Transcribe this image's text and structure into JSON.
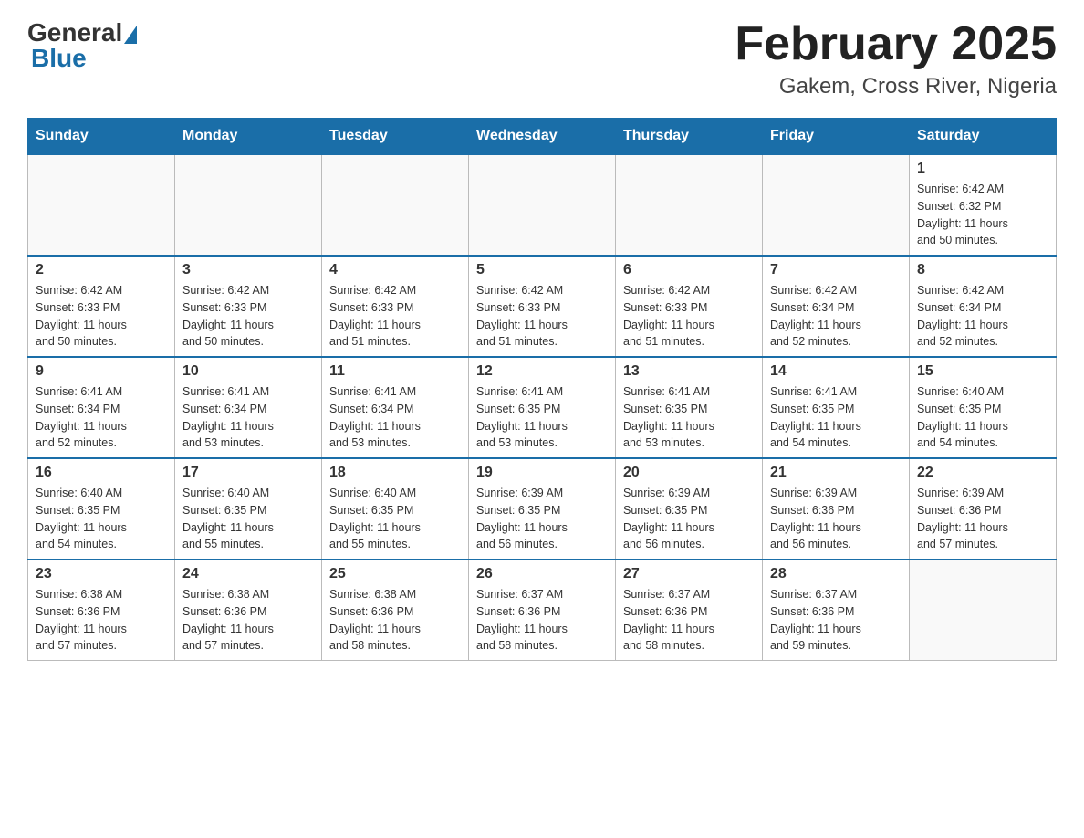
{
  "header": {
    "logo_general": "General",
    "logo_blue": "Blue",
    "title": "February 2025",
    "subtitle": "Gakem, Cross River, Nigeria"
  },
  "weekdays": [
    "Sunday",
    "Monday",
    "Tuesday",
    "Wednesday",
    "Thursday",
    "Friday",
    "Saturday"
  ],
  "weeks": [
    [
      {
        "day": "",
        "info": ""
      },
      {
        "day": "",
        "info": ""
      },
      {
        "day": "",
        "info": ""
      },
      {
        "day": "",
        "info": ""
      },
      {
        "day": "",
        "info": ""
      },
      {
        "day": "",
        "info": ""
      },
      {
        "day": "1",
        "info": "Sunrise: 6:42 AM\nSunset: 6:32 PM\nDaylight: 11 hours\nand 50 minutes."
      }
    ],
    [
      {
        "day": "2",
        "info": "Sunrise: 6:42 AM\nSunset: 6:33 PM\nDaylight: 11 hours\nand 50 minutes."
      },
      {
        "day": "3",
        "info": "Sunrise: 6:42 AM\nSunset: 6:33 PM\nDaylight: 11 hours\nand 50 minutes."
      },
      {
        "day": "4",
        "info": "Sunrise: 6:42 AM\nSunset: 6:33 PM\nDaylight: 11 hours\nand 51 minutes."
      },
      {
        "day": "5",
        "info": "Sunrise: 6:42 AM\nSunset: 6:33 PM\nDaylight: 11 hours\nand 51 minutes."
      },
      {
        "day": "6",
        "info": "Sunrise: 6:42 AM\nSunset: 6:33 PM\nDaylight: 11 hours\nand 51 minutes."
      },
      {
        "day": "7",
        "info": "Sunrise: 6:42 AM\nSunset: 6:34 PM\nDaylight: 11 hours\nand 52 minutes."
      },
      {
        "day": "8",
        "info": "Sunrise: 6:42 AM\nSunset: 6:34 PM\nDaylight: 11 hours\nand 52 minutes."
      }
    ],
    [
      {
        "day": "9",
        "info": "Sunrise: 6:41 AM\nSunset: 6:34 PM\nDaylight: 11 hours\nand 52 minutes."
      },
      {
        "day": "10",
        "info": "Sunrise: 6:41 AM\nSunset: 6:34 PM\nDaylight: 11 hours\nand 53 minutes."
      },
      {
        "day": "11",
        "info": "Sunrise: 6:41 AM\nSunset: 6:34 PM\nDaylight: 11 hours\nand 53 minutes."
      },
      {
        "day": "12",
        "info": "Sunrise: 6:41 AM\nSunset: 6:35 PM\nDaylight: 11 hours\nand 53 minutes."
      },
      {
        "day": "13",
        "info": "Sunrise: 6:41 AM\nSunset: 6:35 PM\nDaylight: 11 hours\nand 53 minutes."
      },
      {
        "day": "14",
        "info": "Sunrise: 6:41 AM\nSunset: 6:35 PM\nDaylight: 11 hours\nand 54 minutes."
      },
      {
        "day": "15",
        "info": "Sunrise: 6:40 AM\nSunset: 6:35 PM\nDaylight: 11 hours\nand 54 minutes."
      }
    ],
    [
      {
        "day": "16",
        "info": "Sunrise: 6:40 AM\nSunset: 6:35 PM\nDaylight: 11 hours\nand 54 minutes."
      },
      {
        "day": "17",
        "info": "Sunrise: 6:40 AM\nSunset: 6:35 PM\nDaylight: 11 hours\nand 55 minutes."
      },
      {
        "day": "18",
        "info": "Sunrise: 6:40 AM\nSunset: 6:35 PM\nDaylight: 11 hours\nand 55 minutes."
      },
      {
        "day": "19",
        "info": "Sunrise: 6:39 AM\nSunset: 6:35 PM\nDaylight: 11 hours\nand 56 minutes."
      },
      {
        "day": "20",
        "info": "Sunrise: 6:39 AM\nSunset: 6:35 PM\nDaylight: 11 hours\nand 56 minutes."
      },
      {
        "day": "21",
        "info": "Sunrise: 6:39 AM\nSunset: 6:36 PM\nDaylight: 11 hours\nand 56 minutes."
      },
      {
        "day": "22",
        "info": "Sunrise: 6:39 AM\nSunset: 6:36 PM\nDaylight: 11 hours\nand 57 minutes."
      }
    ],
    [
      {
        "day": "23",
        "info": "Sunrise: 6:38 AM\nSunset: 6:36 PM\nDaylight: 11 hours\nand 57 minutes."
      },
      {
        "day": "24",
        "info": "Sunrise: 6:38 AM\nSunset: 6:36 PM\nDaylight: 11 hours\nand 57 minutes."
      },
      {
        "day": "25",
        "info": "Sunrise: 6:38 AM\nSunset: 6:36 PM\nDaylight: 11 hours\nand 58 minutes."
      },
      {
        "day": "26",
        "info": "Sunrise: 6:37 AM\nSunset: 6:36 PM\nDaylight: 11 hours\nand 58 minutes."
      },
      {
        "day": "27",
        "info": "Sunrise: 6:37 AM\nSunset: 6:36 PM\nDaylight: 11 hours\nand 58 minutes."
      },
      {
        "day": "28",
        "info": "Sunrise: 6:37 AM\nSunset: 6:36 PM\nDaylight: 11 hours\nand 59 minutes."
      },
      {
        "day": "",
        "info": ""
      }
    ]
  ]
}
